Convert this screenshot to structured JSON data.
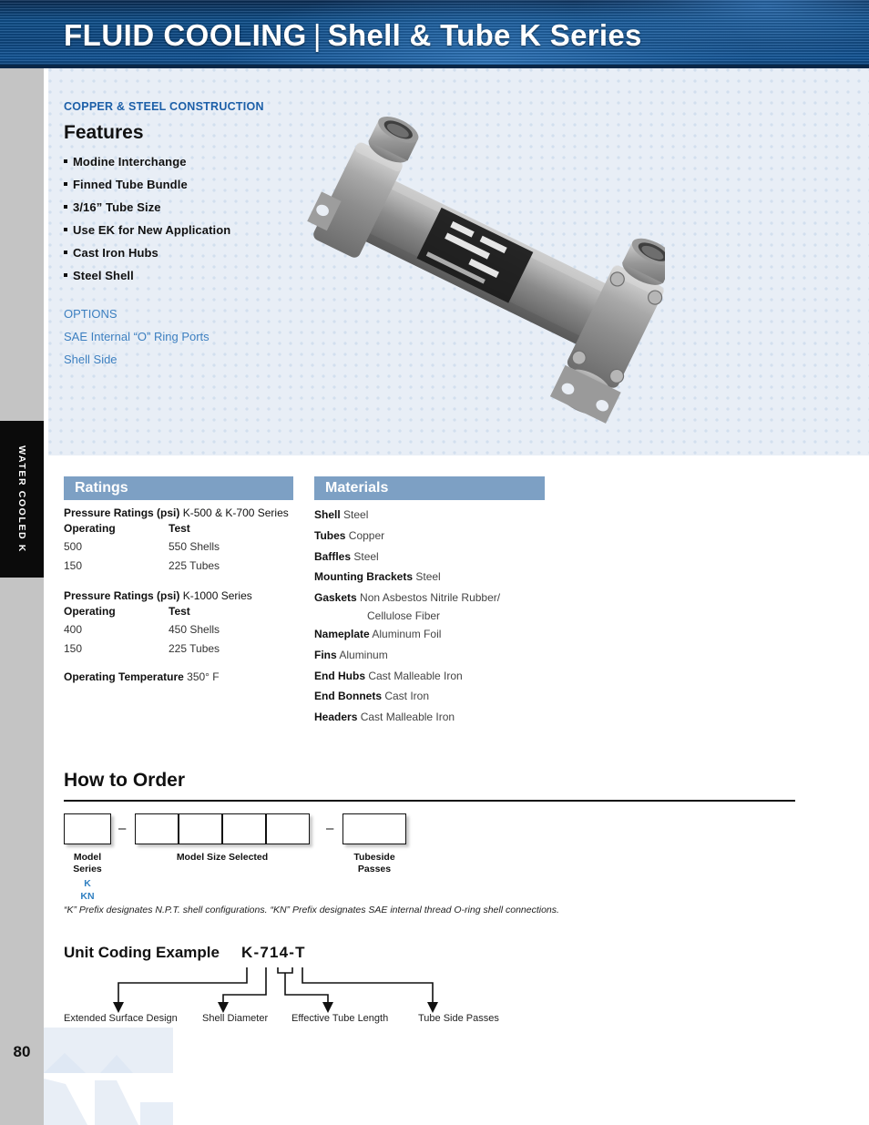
{
  "banner": {
    "title_main": "FLUID COOLING",
    "separator": "|",
    "title_sub": "Shell & Tube K Series"
  },
  "side_tab": {
    "label": "WATER COOLED  K"
  },
  "page_number": "80",
  "hero": {
    "kicker": "COPPER & STEEL CONSTRUCTION",
    "features_heading": "Features",
    "features": [
      "Modine Interchange",
      "Finned Tube Bundle",
      "3/16” Tube Size",
      "Use EK for New Application",
      "Cast Iron Hubs",
      "Steel Shell"
    ],
    "options_title": "OPTIONS",
    "options": [
      "SAE Internal “O” Ring Ports",
      "Shell Side"
    ]
  },
  "ratings": {
    "bar_label": "Ratings",
    "group1": {
      "title_bold": "Pressure Ratings (psi)",
      "title_rest": " K-500 & K-700 Series",
      "col1": "Operating",
      "col2": "Test",
      "rows": [
        {
          "operating": "500",
          "test": "550 Shells"
        },
        {
          "operating": "150",
          "test": "225 Tubes"
        }
      ]
    },
    "group2": {
      "title_bold": "Pressure Ratings (psi)",
      "title_rest": " K-1000 Series",
      "col1": "Operating",
      "col2": "Test",
      "rows": [
        {
          "operating": "400",
          "test": "450 Shells"
        },
        {
          "operating": "150",
          "test": "225 Tubes"
        }
      ]
    },
    "operating_temp_label": "Operating Temperature",
    "operating_temp_value": " 350° F"
  },
  "materials": {
    "bar_label": "Materials",
    "rows": [
      {
        "name": "Shell",
        "value": " Steel"
      },
      {
        "name": "Tubes",
        "value": " Copper"
      },
      {
        "name": "Baffles",
        "value": " Steel"
      },
      {
        "name": "Mounting Brackets",
        "value": " Steel"
      },
      {
        "name": "Gaskets",
        "value": " Non Asbestos Nitrile Rubber/",
        "continuation": "Cellulose Fiber"
      },
      {
        "name": "Nameplate",
        "value": " Aluminum Foil"
      },
      {
        "name": "Fins",
        "value": " Aluminum"
      },
      {
        "name": "End Hubs",
        "value": " Cast Malleable Iron"
      },
      {
        "name": "End Bonnets",
        "value": " Cast Iron"
      },
      {
        "name": "Headers",
        "value": " Cast Malleable Iron"
      }
    ]
  },
  "how_to_order": {
    "title": "How to Order",
    "dash1": "–",
    "dash2": "–",
    "label_model_series_l1": "Model",
    "label_model_series_l2": "Series",
    "option_k": "K",
    "option_kn": "KN",
    "label_model_size": "Model Size Selected",
    "label_tubeside_l1": "Tubeside",
    "label_tubeside_l2": "Passes",
    "footnote": "“K” Prefix designates N.P.T. shell configurations. “KN” Prefix designates SAE internal thread O-ring shell connections."
  },
  "unit_coding": {
    "title": "Unit Coding Example",
    "code": "K-714-T",
    "labels": [
      "Extended Surface Design",
      "Shell Diameter",
      "Effective Tube Length",
      "Tube Side Passes"
    ]
  },
  "colors": {
    "banner_blue": "#10528f",
    "accent_blue": "#3c7fc0",
    "section_bar": "#7da0c4",
    "kicker_blue": "#1c5fa8",
    "panel_bg": "#e8eef6",
    "gray_strip": "#c4c4c4",
    "tab_black": "#0b0b0b"
  }
}
